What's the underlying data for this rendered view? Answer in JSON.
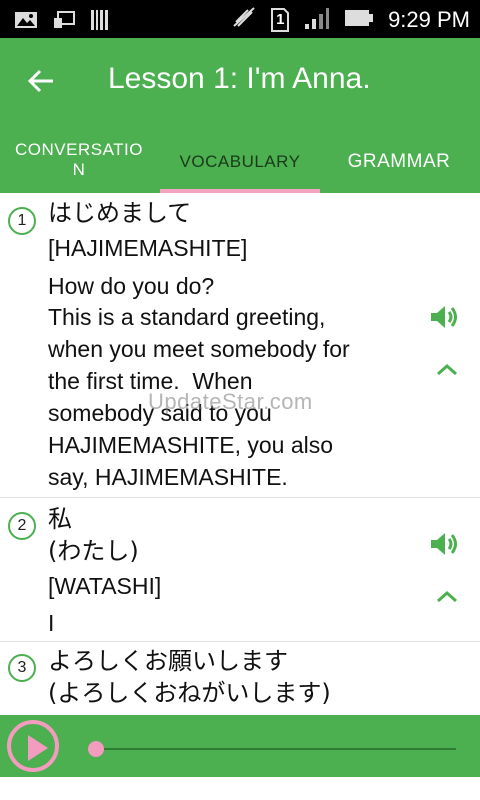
{
  "status_bar": {
    "time": "9:29 PM",
    "sim_badge": "1",
    "icons": [
      "image-icon",
      "cast-icon",
      "barcode-icon",
      "mute-icon",
      "sim-icon",
      "signal-icon",
      "battery-icon"
    ]
  },
  "app_bar": {
    "title": "Lesson 1: I'm Anna.",
    "back_icon": "arrow-back-icon",
    "background": "#4caf50"
  },
  "tabs": [
    {
      "label": "CONVERSATION",
      "selected": false
    },
    {
      "label": "VOCABULARY",
      "selected": true
    },
    {
      "label": "GRAMMAR",
      "selected": false
    }
  ],
  "accent_color": "#f49bc0",
  "vocabulary": [
    {
      "number": "1",
      "japanese": "はじめまして",
      "romaji": "[HAJIMEMASHITE]",
      "meaning_lines": [
        "How do you do?",
        "This is a standard greeting,",
        "when you meet somebody for",
        "the first time.  When",
        "somebody said to you",
        "HAJIMEMASHITE, you also",
        "say, HAJIMEMASHITE."
      ]
    },
    {
      "number": "2",
      "japanese": "私",
      "reading": "(わたし)",
      "romaji": "[WATASHI]",
      "meaning": "I"
    },
    {
      "number": "3",
      "japanese": "よろしくお願いします",
      "reading": "(よろしくおねがいします)"
    }
  ],
  "watermark": "UpdateStar.com",
  "player": {
    "progress": 0
  }
}
